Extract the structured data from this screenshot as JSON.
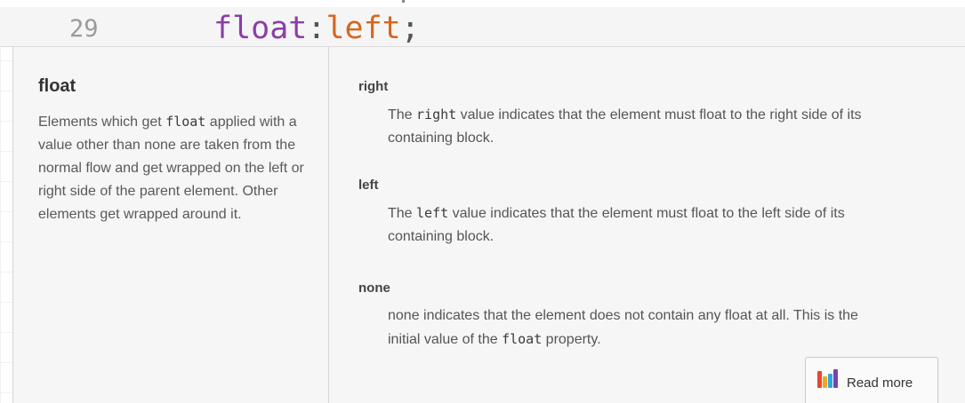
{
  "editor": {
    "line_number": "29",
    "code": {
      "property": "float",
      "colon": ":",
      "value": "left",
      "semicolon": ";"
    }
  },
  "tooltip": {
    "summary": {
      "title": "float",
      "text_parts": [
        "Elements which get ",
        "float",
        " applied with a value other than ",
        "none",
        " are taken from the normal flow and get wrapped on the left or right side of the parent element. Other elements get wrapped around it."
      ]
    },
    "values": [
      {
        "name": "right",
        "line1": [
          "The ",
          "right",
          " value indicates that the element must float to the right side of its"
        ],
        "line2": "containing block."
      },
      {
        "name": "left",
        "line1": [
          "The ",
          "left",
          " value indicates that the element must float to the left side of its"
        ],
        "line2": "containing block."
      },
      {
        "name": "none",
        "line1": [
          "none indicates that the element does not contain any float at all. This is the"
        ],
        "line2_parts": [
          "initial value of the ",
          "float",
          " property."
        ]
      }
    ],
    "read_more_label": "Read more",
    "read_more_icon": "webplatform-w-icon"
  },
  "colors": {
    "css_property": "#8a3ea7",
    "css_value": "#d4671f",
    "panel_background": "#f6f6f6"
  }
}
